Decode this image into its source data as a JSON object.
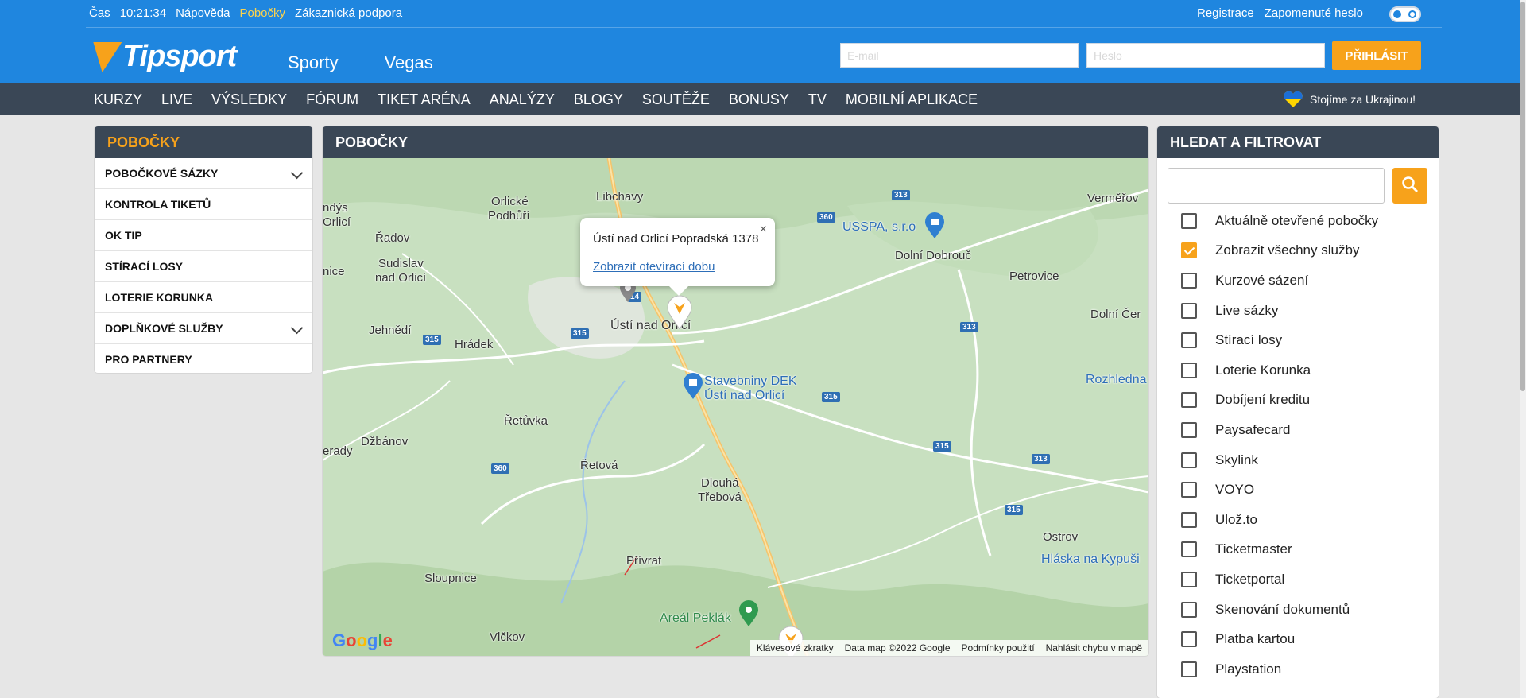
{
  "topbar": {
    "links": [
      "Čas",
      "10:21:34",
      "Nápověda",
      "Pobočky",
      "Zákaznická podpora"
    ],
    "active_index": 3,
    "right_links": [
      "Registrace",
      "Zapomenuté heslo"
    ]
  },
  "header": {
    "logo": "Tipsport",
    "nav": [
      "Sporty",
      "Vegas"
    ],
    "email_placeholder": "E-mail",
    "password_placeholder": "Heslo",
    "login_label": "PŘIHLÁSIT"
  },
  "subnav": {
    "items": [
      "KURZY",
      "LIVE",
      "VÝSLEDKY",
      "FÓRUM",
      "TIKET ARÉNA",
      "ANALÝZY",
      "BLOGY",
      "SOUTĚŽE",
      "BONUSY",
      "TV",
      "MOBILNÍ APLIKACE"
    ],
    "ukraine_label": "Stojíme za Ukrajinou!"
  },
  "sidebar": {
    "title": "POBOČKY",
    "items": [
      {
        "label": "POBOČKOVÉ SÁZKY",
        "expandable": true
      },
      {
        "label": "KONTROLA TIKETŮ",
        "expandable": false
      },
      {
        "label": "OK TIP",
        "expandable": false
      },
      {
        "label": "STÍRACÍ LOSY",
        "expandable": false
      },
      {
        "label": "LOTERIE KORUNKA",
        "expandable": false
      },
      {
        "label": "DOPLŇKOVÉ SLUŽBY",
        "expandable": true
      },
      {
        "label": "PRO PARTNERY",
        "expandable": false
      }
    ]
  },
  "map": {
    "title": "POBOČKY",
    "popup_title": "Ústí nad Orlicí Popradská 1378",
    "popup_link": "Zobrazit otevírací dobu",
    "popup_close": "×",
    "places": {
      "libchavy": "Libchavy",
      "orlicke_1": "Orlické",
      "orlicke_2": "Podhůří",
      "ondys_1": "ndýs",
      "ondys_2": "Orlicí",
      "radov": "Řadov",
      "sudislav_1": "Sudislav",
      "sudislav_2": "nad Orlicí",
      "nice": "nice",
      "jehnedi": "Jehnědí",
      "hradek": "Hrádek",
      "usti": "Ústí nad Orlicí",
      "retuvka": "Řetůvka",
      "rady": "erady",
      "dzbanov": "Džbánov",
      "retova": "Řetová",
      "dlouha_1": "Dlouhá",
      "dlouha_2": "Třebová",
      "privrat": "Přívrat",
      "sloupnice": "Sloupnice",
      "vlckov": "Vlčkov",
      "dolni_dobrouc": "Dolní Dobrouč",
      "petrovice": "Petrovice",
      "dolni_cer": "Dolní Čer",
      "vermerov": "Verměřov",
      "rozhledna": "Rozhledna",
      "ostrov": "Ostrov",
      "haska": "Hláska na Kypuši",
      "usspa": "USSPA, s.r.o",
      "stavebniny_1": "Stavebniny DEK",
      "stavebniny_2": "Ústí nad Orlicí",
      "areal": "Areál Peklák"
    },
    "shields": {
      "s313a": "313",
      "s360a": "360",
      "s360b": "360",
      "s14": "14",
      "s315a": "315",
      "s315b": "315",
      "s315c": "315",
      "s315d": "315",
      "s315e": "315",
      "s313b": "313",
      "s313c": "313",
      "s360c": "360"
    },
    "footer": [
      "Klávesové zkratky",
      "Data map ©2022 Google",
      "Podmínky použití",
      "Nahlásit chybu v mapě"
    ],
    "google": "Google"
  },
  "filters": {
    "title": "HLEDAT A FILTROVAT",
    "search_value": "",
    "options": [
      {
        "label": "Aktuálně otevřené pobočky",
        "checked": false
      },
      {
        "label": "Zobrazit všechny služby",
        "checked": true
      },
      {
        "label": "Kurzové sázení",
        "checked": false
      },
      {
        "label": "Live sázky",
        "checked": false
      },
      {
        "label": "Stírací losy",
        "checked": false
      },
      {
        "label": "Loterie Korunka",
        "checked": false
      },
      {
        "label": "Dobíjení kreditu",
        "checked": false
      },
      {
        "label": "Paysafecard",
        "checked": false
      },
      {
        "label": "Skylink",
        "checked": false
      },
      {
        "label": "VOYO",
        "checked": false
      },
      {
        "label": "Ulož.to",
        "checked": false
      },
      {
        "label": "Ticketmaster",
        "checked": false
      },
      {
        "label": "Ticketportal",
        "checked": false
      },
      {
        "label": "Skenování dokumentů",
        "checked": false
      },
      {
        "label": "Platba kartou",
        "checked": false
      },
      {
        "label": "Playstation",
        "checked": false
      }
    ]
  },
  "colors": {
    "brand_blue": "#1f86df",
    "accent_orange": "#f7a21b",
    "dark_bar": "#3a4756",
    "map_green": "#c8e0c0"
  }
}
